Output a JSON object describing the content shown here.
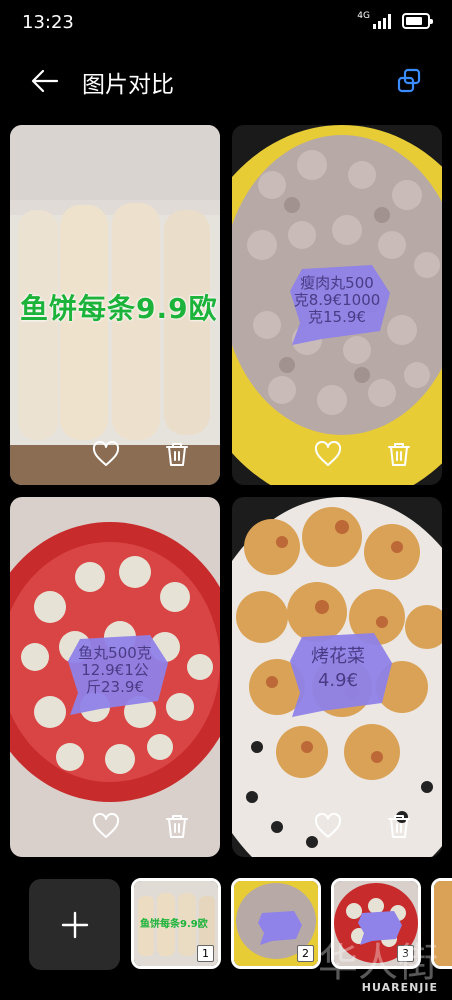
{
  "status_bar": {
    "time": "13:23",
    "network": "4G",
    "battery_level": 0.85
  },
  "app_bar": {
    "title": "图片对比"
  },
  "cards": [
    {
      "label": "鱼饼每条9.9欧",
      "label_style": "green-text"
    },
    {
      "tag_lines": [
        "瘦肉丸500",
        "克8.9€1000",
        "克15.9€"
      ]
    },
    {
      "tag_lines": [
        "鱼丸500克",
        "12.9€1公",
        "斤23.9€"
      ]
    },
    {
      "tag_lines": [
        "烤花菜",
        "4.9€"
      ]
    }
  ],
  "thumbnails": [
    {
      "number": "1",
      "label": "鱼饼每条9.9欧"
    },
    {
      "number": "2"
    },
    {
      "number": "3"
    }
  ],
  "watermark": {
    "text": "HUARENJIE",
    "big": "华人街"
  },
  "colors": {
    "accent": "#3b8cff",
    "tag": "#8f82e8",
    "tag_text": "#4a3b86",
    "green_text": "#1cb33a"
  }
}
